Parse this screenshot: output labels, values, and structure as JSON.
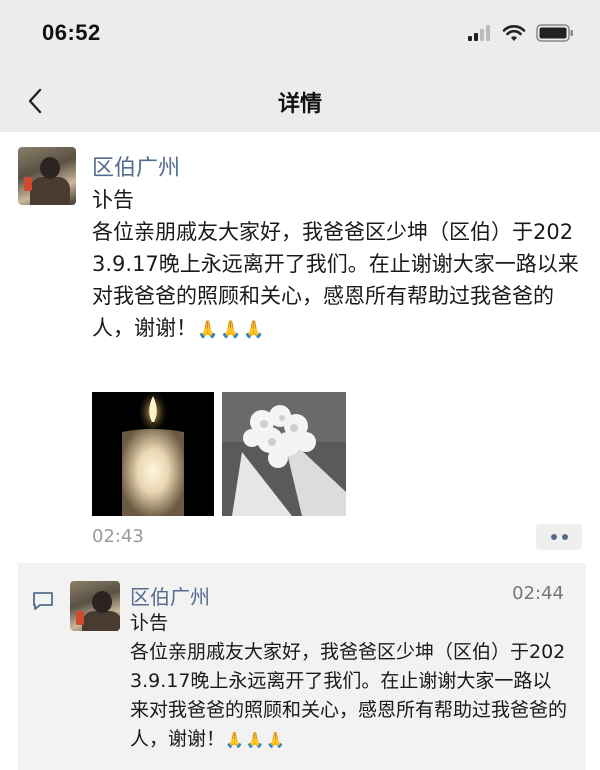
{
  "status_bar": {
    "time": "06:52",
    "icons": [
      "cellular-signal-icon",
      "wifi-icon",
      "battery-icon"
    ]
  },
  "nav": {
    "title": "详情",
    "back_icon": "chevron-left-icon"
  },
  "post": {
    "author": "区伯广州",
    "text": "讣告\n各位亲朋戚友大家好，我爸爸区少坤（区伯）于2023.9.17晚上永远离开了我们。在止谢谢大家一路以来对我爸爸的照顾和关心，感恩所有帮助过我爸爸的人，谢谢！",
    "emoji": "🙏🙏🙏",
    "images": [
      "candle",
      "white-flowers-bouquet"
    ],
    "time": "02:43",
    "more_icon": "more-dots-icon"
  },
  "comment": {
    "icon": "comment-bubble-icon",
    "author": "区伯广州",
    "time": "02:44",
    "text": "讣告\n各位亲朋戚友大家好，我爸爸区少坤（区伯）于2023.9.17晚上永远离开了我们。在止谢谢大家一路以来对我爸爸的照顾和关心，感恩所有帮助过我爸爸的人，谢谢！",
    "emoji": "🙏🙏🙏"
  },
  "colors": {
    "name_link": "#556b8f",
    "header_bg": "#ececec",
    "comment_bg": "#f2f2f2"
  }
}
